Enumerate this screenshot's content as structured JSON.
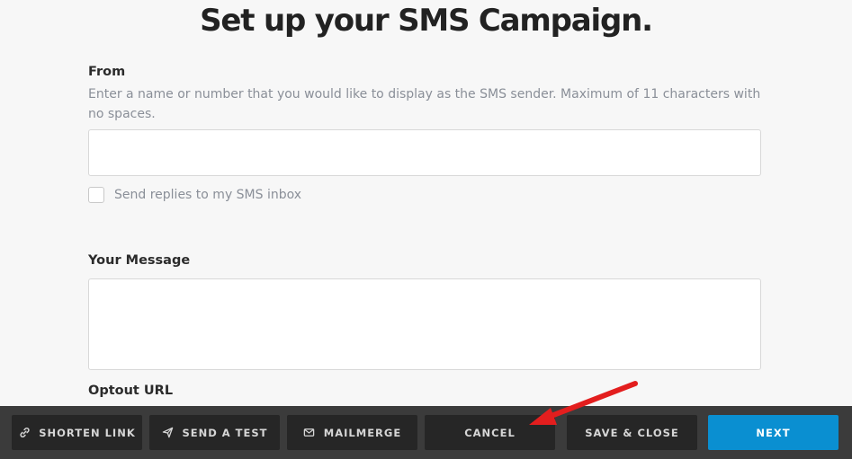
{
  "page": {
    "title": "Set up your SMS Campaign."
  },
  "form": {
    "from": {
      "label": "From",
      "help": "Enter a name or number that you would like to display as the SMS sender. Maximum of 11 characters with no spaces.",
      "value": ""
    },
    "send_replies": {
      "label": "Send replies to my SMS inbox",
      "checked": false
    },
    "message": {
      "label": "Your Message",
      "value": ""
    },
    "optout": {
      "label": "Optout URL"
    }
  },
  "footer": {
    "shorten_link": "SHORTEN LINK",
    "send_test": "SEND A TEST",
    "mailmerge": "MAILMERGE",
    "cancel": "CANCEL",
    "save_close": "SAVE & CLOSE",
    "next": "NEXT"
  },
  "colors": {
    "accent": "#0a8fd1",
    "annotation_arrow": "#e31e1e"
  },
  "icons": {
    "shorten_link": "link-icon",
    "send_test": "paper-plane-icon",
    "mailmerge": "envelope-icon"
  }
}
